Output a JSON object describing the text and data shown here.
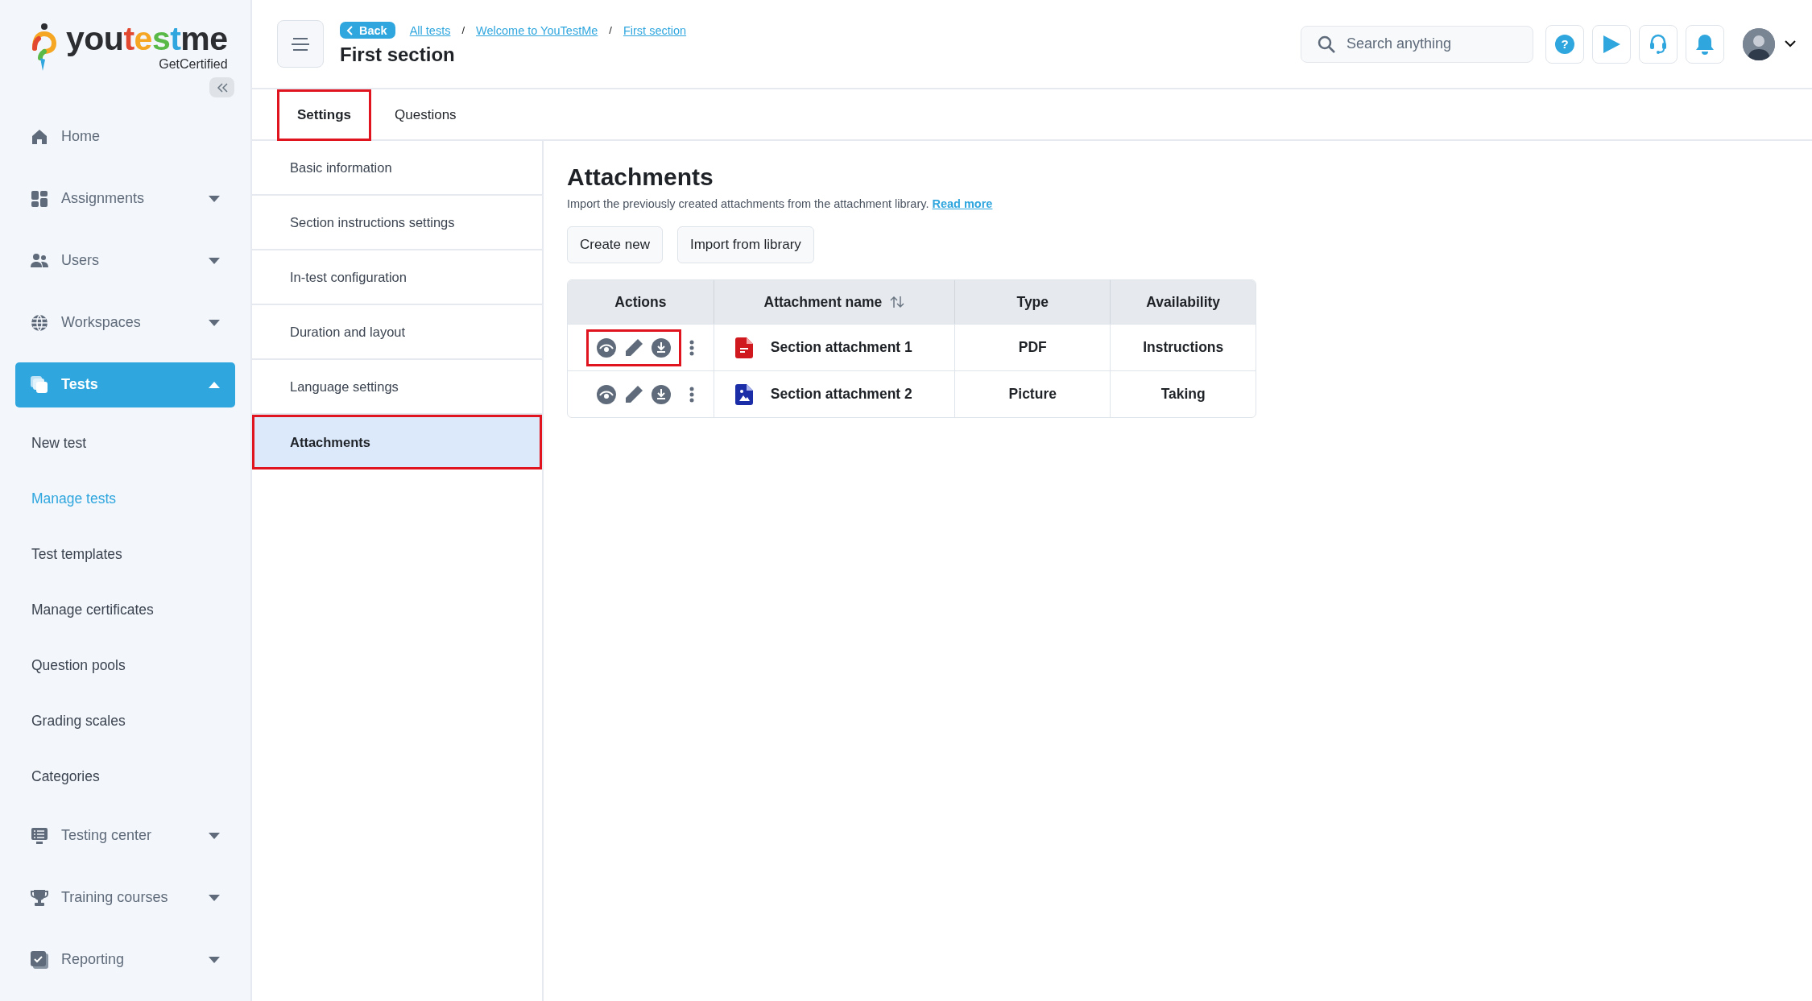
{
  "sidebar": {
    "logo": [
      {
        "text": "you",
        "color": "#2b2d31"
      },
      {
        "text": "t",
        "color": "#e2472f"
      },
      {
        "text": "e",
        "color": "#f5a623"
      },
      {
        "text": "s",
        "color": "#58b947"
      },
      {
        "text": "t",
        "color": "#2fa6de"
      },
      {
        "text": "me",
        "color": "#2b2d31"
      }
    ],
    "tagline": "GetCertified",
    "items": [
      {
        "label": "Home",
        "selected": false
      },
      {
        "label": "Assignments",
        "selected": false,
        "expanded": false
      },
      {
        "label": "Users",
        "selected": false,
        "expanded": false
      },
      {
        "label": "Workspaces",
        "selected": false,
        "expanded": false
      },
      {
        "label": "Tests",
        "selected": true,
        "expanded": true,
        "children": [
          {
            "label": "New test",
            "selected": false
          },
          {
            "label": "Manage tests",
            "selected": true
          },
          {
            "label": "Test templates",
            "selected": false
          },
          {
            "label": "Manage certificates",
            "selected": false
          },
          {
            "label": "Question pools",
            "selected": false
          },
          {
            "label": "Grading scales",
            "selected": false
          },
          {
            "label": "Categories",
            "selected": false
          }
        ]
      },
      {
        "label": "Testing center",
        "selected": false,
        "expanded": false
      },
      {
        "label": "Training courses",
        "selected": false,
        "expanded": false
      },
      {
        "label": "Reporting",
        "selected": false,
        "expanded": false
      }
    ]
  },
  "header": {
    "back": "Back",
    "breadcrumbs": [
      "All tests",
      "Welcome to YouTestMe",
      "First section"
    ],
    "separators": [
      "/",
      "/"
    ],
    "title": "First section",
    "search": {
      "placeholder": "Search anything"
    },
    "help_symbol": "?"
  },
  "tabs": [
    {
      "label": "Settings",
      "selected": true,
      "highlighted": true
    },
    {
      "label": "Questions",
      "selected": false,
      "highlighted": false
    }
  ],
  "settings_nav": [
    {
      "label": "Basic information",
      "selected": false,
      "highlighted": false
    },
    {
      "label": "Section instructions settings",
      "selected": false,
      "highlighted": false
    },
    {
      "label": "In-test configuration",
      "selected": false,
      "highlighted": false
    },
    {
      "label": "Duration and layout",
      "selected": false,
      "highlighted": false
    },
    {
      "label": "Language settings",
      "selected": false,
      "highlighted": false
    },
    {
      "label": "Attachments",
      "selected": true,
      "highlighted": true
    }
  ],
  "content": {
    "title": "Attachments",
    "description": "Import the previously created attachments from the attachment library.",
    "read_more": "Read more",
    "buttons": [
      "Create new",
      "Import from library"
    ],
    "table": {
      "columns": [
        {
          "label": "Actions",
          "sortable": false
        },
        {
          "label": "Attachment name",
          "sortable": true
        },
        {
          "label": "Type",
          "sortable": false
        },
        {
          "label": "Availability",
          "sortable": false
        }
      ],
      "rows": [
        {
          "kind": "pdf",
          "name": "Section attachment 1",
          "type": "PDF",
          "availability": "Instructions",
          "highlighted": true
        },
        {
          "kind": "picture",
          "name": "Section attachment 2",
          "type": "Picture",
          "availability": "Taking",
          "highlighted": false
        }
      ]
    }
  }
}
